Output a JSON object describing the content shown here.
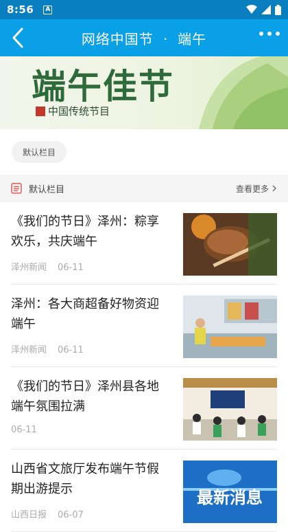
{
  "status_bar": {
    "time": "8:56",
    "notif_icon": "A"
  },
  "header": {
    "title_left": "网络中国节",
    "separator": "·",
    "title_right": "端午"
  },
  "banner": {
    "title": "端午佳节",
    "subtitle": "中国传统节目"
  },
  "chip": {
    "label": "默认栏目"
  },
  "section": {
    "label": "默认栏目",
    "more_label": "查看更多"
  },
  "news": [
    {
      "headline": "《我们的节日》泽州：粽享欢乐，共庆端午",
      "source": "泽州新闻",
      "date": "06-11"
    },
    {
      "headline": "泽州：各大商超备好物资迎端午",
      "source": "泽州新闻",
      "date": "06-11"
    },
    {
      "headline": "《我们的节日》泽州县各地端午氛围拉满",
      "source": "",
      "date": "06-11"
    },
    {
      "headline": "山西省文旅厅发布端午节假期出游提示",
      "source": "山西日报",
      "date": "06-07"
    }
  ],
  "thumb4_text": "最新消息",
  "colors": {
    "header": "#0aa0e8",
    "status": "#0a7fbf",
    "banner_text": "#2f6b3a"
  }
}
